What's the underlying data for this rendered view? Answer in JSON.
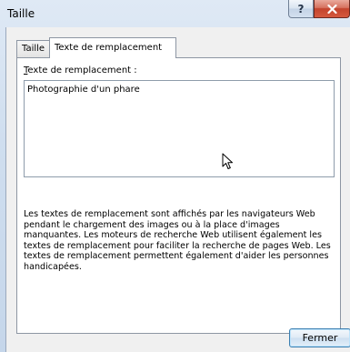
{
  "window": {
    "title": "Taille",
    "help_glyph": "?",
    "close_icon": "close-x-icon"
  },
  "tabs": [
    {
      "label": "Taille",
      "active": false
    },
    {
      "label": "Texte de remplacement",
      "active": true
    }
  ],
  "alt_text": {
    "label_accesskey": "T",
    "label_rest": "exte de remplacement :",
    "value": "Photographie d'un phare"
  },
  "description": "Les textes de remplacement sont affichés par les navigateurs Web pendant le chargement des images ou à la place d'images manquantes. Les moteurs de recherche Web utilisent également les textes de remplacement pour faciliter la recherche de pages Web. Les textes de remplacement permettent également d'aider les personnes handicapées.",
  "buttons": {
    "close_label": "Fermer"
  },
  "colors": {
    "close_button": "#c3442d",
    "focus_border": "#3c7fb1"
  }
}
